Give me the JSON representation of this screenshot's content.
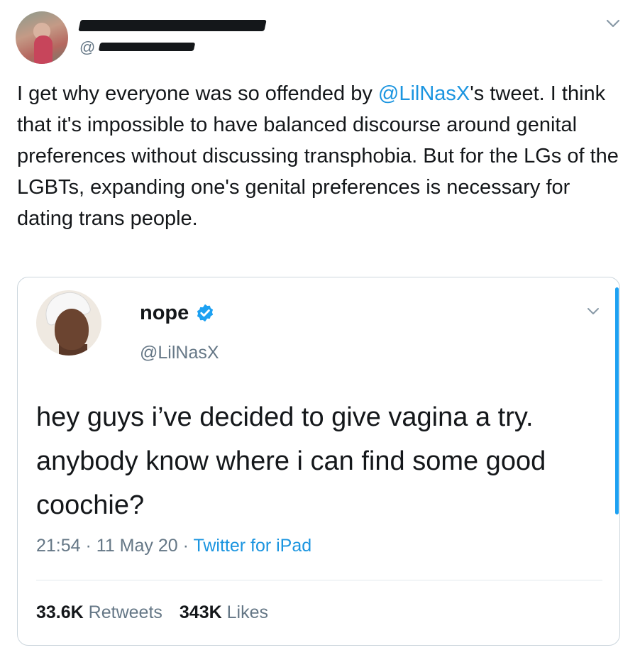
{
  "tweet": {
    "author": {
      "handle_prefix": "@"
    },
    "text_before_mention": "I get why everyone was so offended by ",
    "mention": "@LilNasX",
    "text_after_mention": "'s tweet. I think that it's impossible to have balanced discourse around genital preferences without discussing transphobia. But for the LGs of the LGBTs, expanding one's genital preferences is necessary for dating trans people.",
    "menu_icon": "chevron-down-icon"
  },
  "quoted_tweet": {
    "author": {
      "name": "nope",
      "handle": "@LilNasX",
      "verified_icon": "verified-badge-icon"
    },
    "text": "hey guys i’ve decided to give vagina a try. anybody know where i can find some good coochie?",
    "time": "21:54",
    "date": "11 May 20",
    "separator": " · ",
    "source": "Twitter for iPad",
    "retweets_count": "33.6K",
    "retweets_label": "Retweets",
    "likes_count": "343K",
    "likes_label": "Likes",
    "menu_icon": "chevron-down-icon"
  },
  "colors": {
    "link": "#1b95e0",
    "verified": "#1da1f2",
    "secondary_text": "#657786",
    "border": "#ccd6dd"
  }
}
